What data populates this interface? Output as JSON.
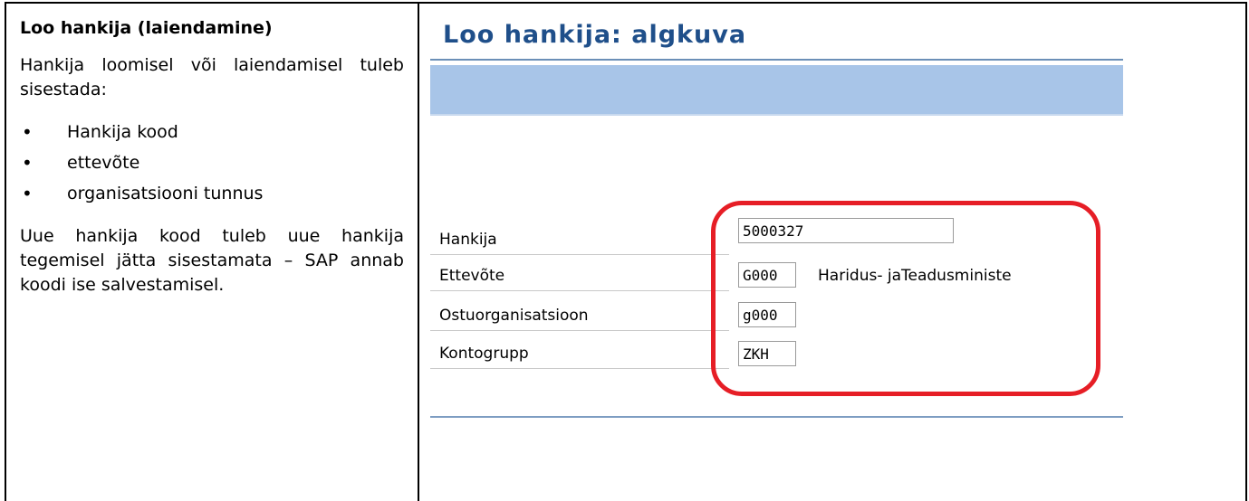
{
  "left_panel": {
    "heading": "Loo hankija (laiendamine)",
    "intro": "Hankija loomisel või laiendamisel tuleb sisestada:",
    "bullets": [
      "Hankija kood",
      "ettevõte",
      "organisatsiooni tunnus"
    ],
    "note": "Uue hankija kood tuleb uue hankija tegemisel jätta sisestamata – SAP annab koodi ise salvestamisel."
  },
  "sap_screen": {
    "title": "Loo hankija:  algkuva",
    "fields": [
      {
        "label": "Hankija",
        "value": "5000327",
        "description": ""
      },
      {
        "label": "Ettevõte",
        "value": "G000",
        "description": "Haridus- jaTeadusministe"
      },
      {
        "label": "Ostuorganisatsioon",
        "value": "g000",
        "description": ""
      },
      {
        "label": "Kontogrupp",
        "value": "ZKH",
        "description": ""
      }
    ],
    "highlight_color": "#e61e26",
    "band_color": "#a8c5e8",
    "title_color": "#1f4f8a"
  }
}
